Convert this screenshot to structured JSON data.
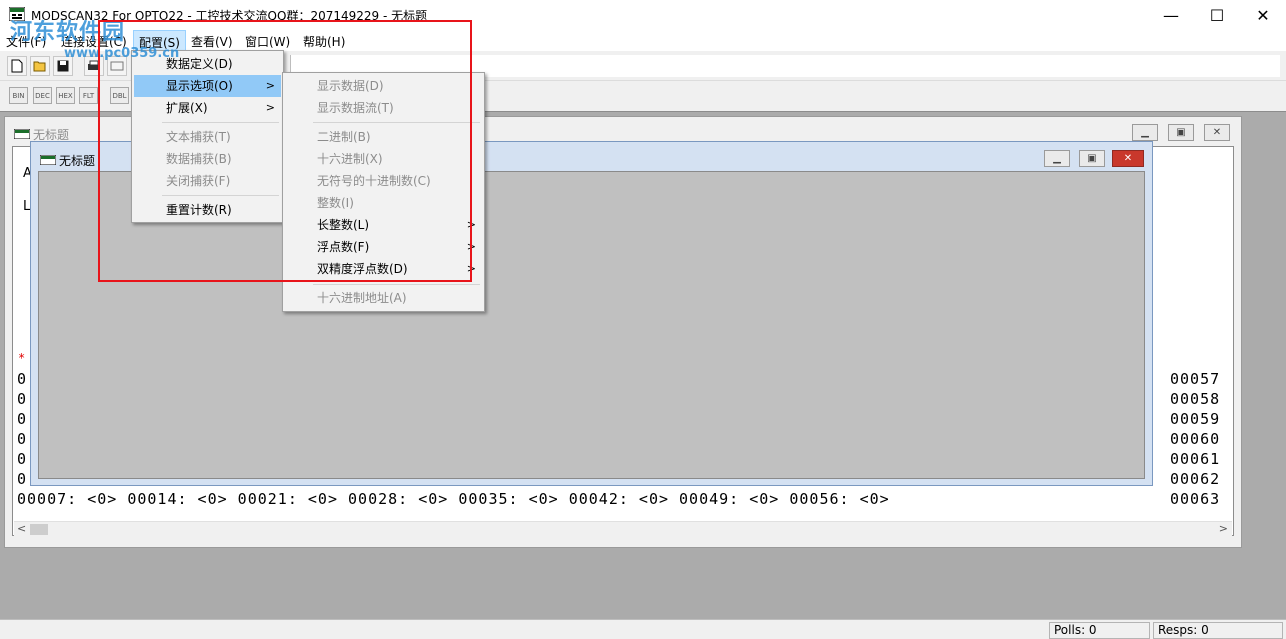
{
  "window": {
    "title": "MODSCAN32 For OPTO22 - 工控技术交流QQ群：207149229 - 无标题",
    "minimize": "—",
    "maximize": "☐",
    "close": "✕"
  },
  "watermark": {
    "text": "河东软件园",
    "url": "www.pc0359.cn"
  },
  "menubar": {
    "file": "文件(F)",
    "connect": "连接设置(C)",
    "config": "配置(S)",
    "view": "查看(V)",
    "window": "窗口(W)",
    "help": "帮助(H)"
  },
  "toolbar2": [
    "BIN",
    "DEC",
    "HEX",
    "FLT",
    "DBL"
  ],
  "config_menu": {
    "items": [
      {
        "label": "数据定义(D)",
        "enabled": true
      },
      {
        "label": "显示选项(O)",
        "enabled": true,
        "submenu": true,
        "highlighted": true
      },
      {
        "label": "扩展(X)",
        "enabled": true,
        "submenu": true
      },
      {
        "label": "文本捕获(T)",
        "enabled": false
      },
      {
        "label": "数据捕获(B)",
        "enabled": false
      },
      {
        "label": "关闭捕获(F)",
        "enabled": false
      },
      {
        "label": "重置计数(R)",
        "enabled": true
      }
    ]
  },
  "display_submenu": {
    "items": [
      {
        "label": "显示数据(D)",
        "enabled": false
      },
      {
        "label": "显示数据流(T)",
        "enabled": false
      },
      {
        "label": "二进制(B)",
        "enabled": false
      },
      {
        "label": "十六进制(X)",
        "enabled": false
      },
      {
        "label": "无符号的十进制数(C)",
        "enabled": false
      },
      {
        "label": "整数(I)",
        "enabled": false
      },
      {
        "label": "长整数(L)",
        "enabled": true,
        "submenu": true
      },
      {
        "label": "浮点数(F)",
        "enabled": true,
        "submenu": true
      },
      {
        "label": "双精度浮点数(D)",
        "enabled": true,
        "submenu": true
      },
      {
        "label": "十六进制地址(A)",
        "enabled": false
      }
    ]
  },
  "child_back": {
    "title": "无标题",
    "label_a": "A",
    "label_l": "L",
    "red_marker": "*",
    "left_col": [
      "0",
      "0",
      "0",
      "0",
      "0",
      "0"
    ],
    "right_col": [
      "00057",
      "00058",
      "00059",
      "00060",
      "00061",
      "00062",
      "00063"
    ],
    "bottom_row": "00007: <0>  00014: <0>  00021: <0>  00028: <0>  00035: <0>  00042: <0>  00049: <0>  00056: <0>"
  },
  "child_front": {
    "title": "无标题"
  },
  "statusbar": {
    "polls": "Polls: 0",
    "resps": "Resps: 0"
  }
}
